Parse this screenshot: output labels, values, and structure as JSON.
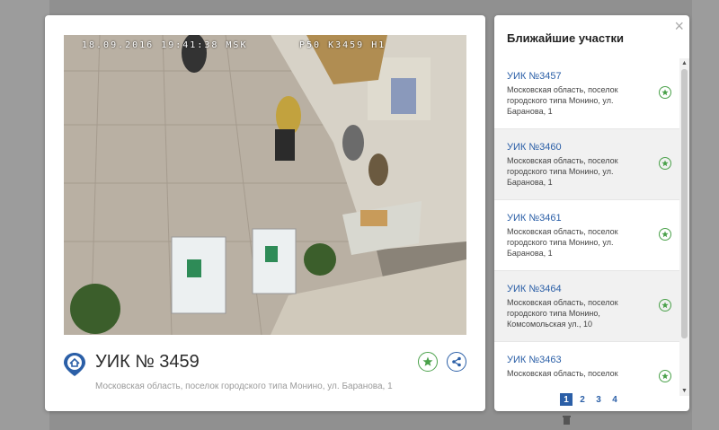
{
  "camera": {
    "osd_left": "18.09.2016 19:41:38 MSK",
    "osd_right": "P50 K3459 H1"
  },
  "uik": {
    "title": "УИК № 3459",
    "address": "Московская область, поселок городского типа Монино, ул. Баранова, 1",
    "pin_icon": "home-pin-icon",
    "favorite_icon": "star-icon",
    "share_icon": "share-icon"
  },
  "nearby": {
    "title": "Ближайшие участки",
    "close": "×",
    "items": [
      {
        "name": "УИК №3457",
        "address": "Московская область, поселок городского типа Монино, ул. Баранова, 1"
      },
      {
        "name": "УИК №3460",
        "address": "Московская область, поселок городского типа Монино, ул. Баранова, 1"
      },
      {
        "name": "УИК №3461",
        "address": "Московская область, поселок городского типа Монино, ул. Баранова, 1"
      },
      {
        "name": "УИК №3464",
        "address": "Московская область, поселок городского типа Монино, Комсомольская ул., 10"
      },
      {
        "name": "УИК №3463",
        "address": "Московская область, поселок"
      }
    ],
    "pages": [
      "1",
      "2",
      "3",
      "4"
    ],
    "active_page": "1"
  },
  "colors": {
    "accent_blue": "#2b5fa7",
    "accent_green": "#4aa14a"
  }
}
